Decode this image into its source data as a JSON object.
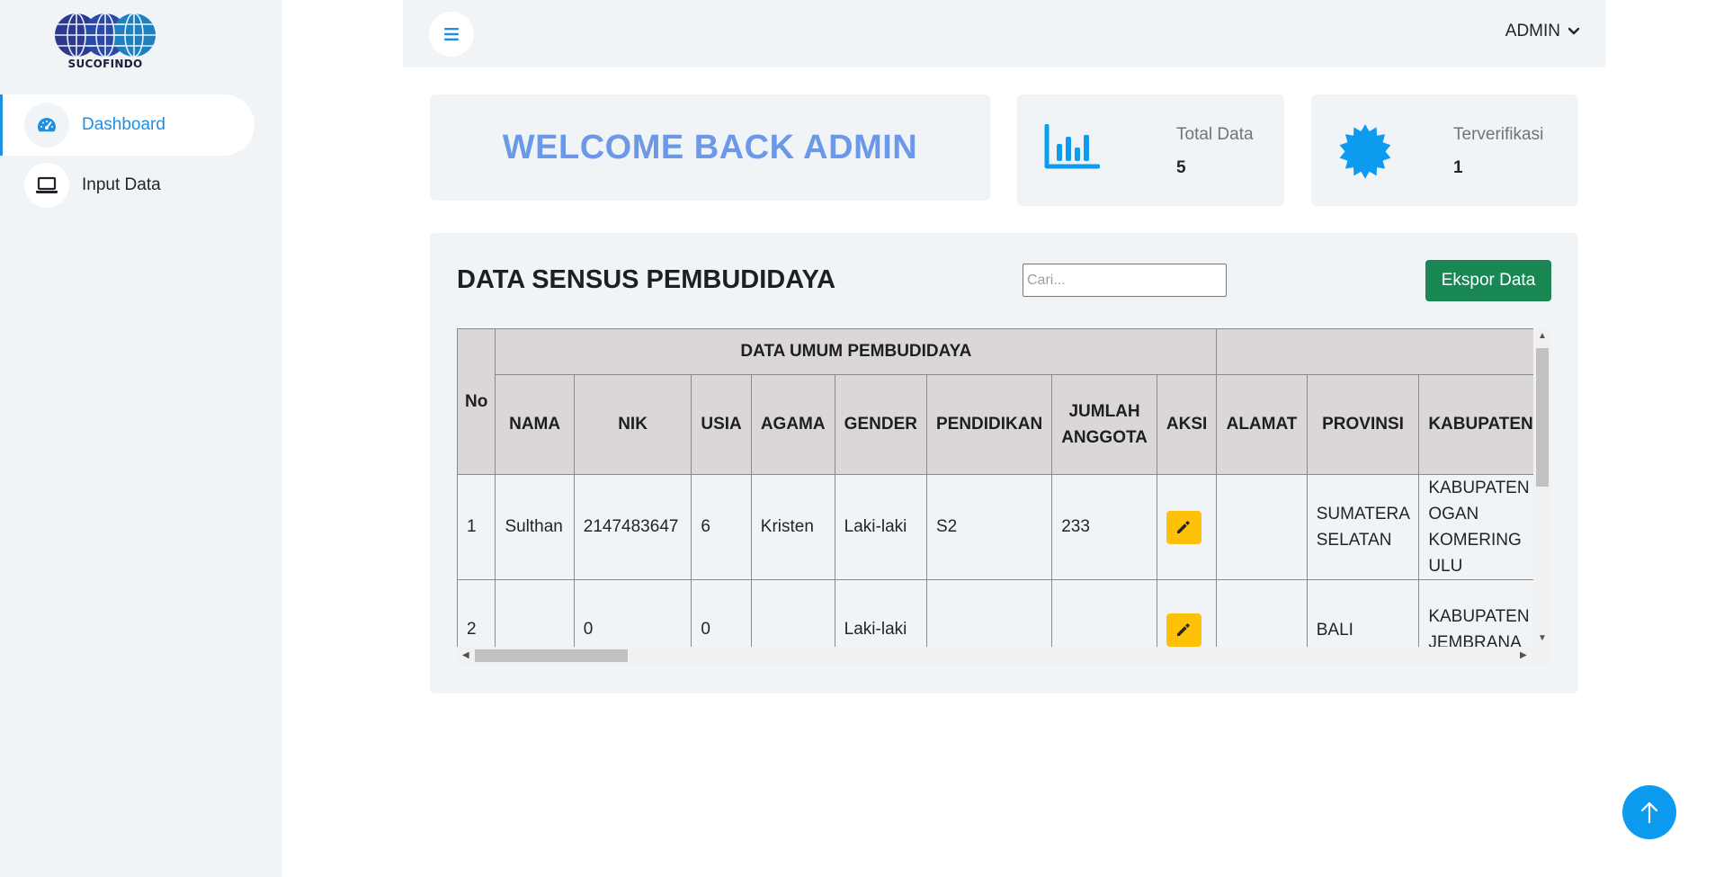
{
  "brand": {
    "logo_text": "SUCOFINDO"
  },
  "sidebar": {
    "items": [
      {
        "label": "Dashboard",
        "icon": "speedometer-icon",
        "active": true
      },
      {
        "label": "Input Data",
        "icon": "laptop-icon",
        "active": false
      }
    ]
  },
  "topbar": {
    "user_label": "ADMIN"
  },
  "welcome": {
    "text": "WELCOME BACK ADMIN"
  },
  "stats": [
    {
      "label": "Total Data",
      "value": "5",
      "icon": "bar-chart-icon"
    },
    {
      "label": "Terverifikasi",
      "value": "1",
      "icon": "verified-badge-icon"
    }
  ],
  "data_section": {
    "title": "DATA SENSUS PEMBUDIDAYA",
    "search_placeholder": "Cari...",
    "export_label": "Ekspor Data",
    "table": {
      "no_header": "No",
      "group_header": "DATA UMUM PEMBUDIDAYA",
      "columns": [
        "NAMA",
        "NIK",
        "USIA",
        "AGAMA",
        "GENDER",
        "PENDIDIKAN",
        "JUMLAH ANGGOTA",
        "AKSI",
        "ALAMAT",
        "PROVINSI",
        "KABUPATEN/"
      ],
      "rows": [
        {
          "no": "1",
          "nama": "Sulthan",
          "nik": "2147483647",
          "usia": "6",
          "agama": "Kristen",
          "gender": "Laki-laki",
          "pendidikan": "S2",
          "jumlah_anggota": "233",
          "alamat": "",
          "provinsi": "SUMATERA SELATAN",
          "kabupaten": "KABUPATEN OGAN KOMERING ULU"
        },
        {
          "no": "2",
          "nama": "",
          "nik": "0",
          "usia": "0",
          "agama": "",
          "gender": "Laki-laki",
          "pendidikan": "",
          "jumlah_anggota": "",
          "alamat": "",
          "provinsi": "BALI",
          "kabupaten": "KABUPATEN JEMBRANA"
        }
      ]
    }
  },
  "colors": {
    "accent": "#1e8fe1",
    "welcome_text": "#6b98e8",
    "export_button": "#198754",
    "edit_button": "#ffc107",
    "scroll_top_button": "#0d9bf0",
    "panel_bg": "#f0f4f7"
  }
}
